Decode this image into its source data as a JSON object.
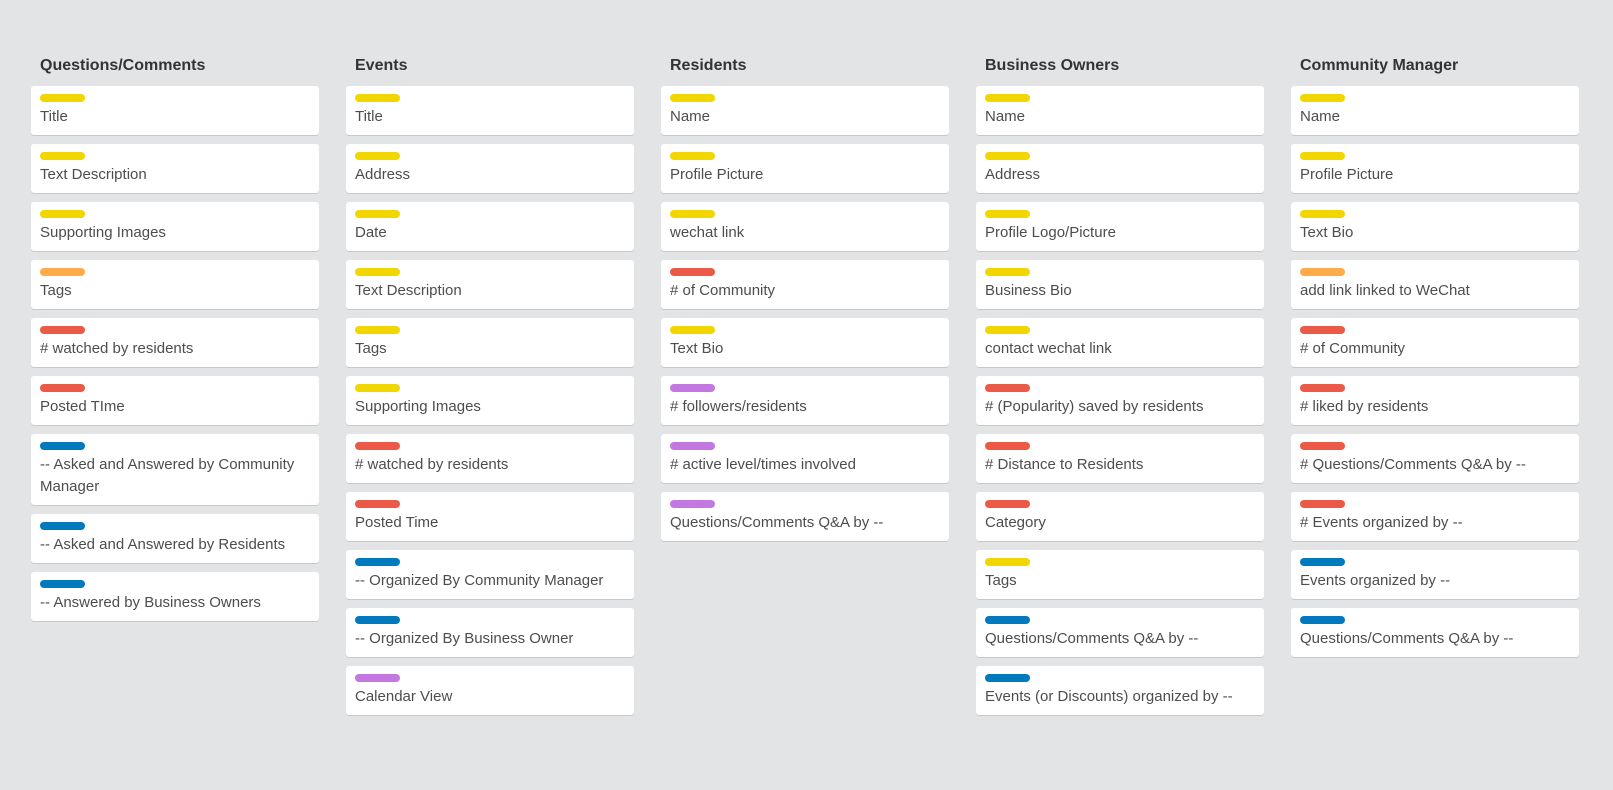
{
  "label_colors": {
    "yellow": "#f2d600",
    "orange": "#ffab4a",
    "red": "#eb5a46",
    "blue": "#0079bf",
    "purple": "#c377e0"
  },
  "board": {
    "lists": [
      {
        "title": "Questions/Comments",
        "cards": [
          {
            "label": "yellow",
            "text": "Title"
          },
          {
            "label": "yellow",
            "text": "Text Description"
          },
          {
            "label": "yellow",
            "text": "Supporting Images"
          },
          {
            "label": "orange",
            "text": "Tags"
          },
          {
            "label": "red",
            "text": "# watched by residents"
          },
          {
            "label": "red",
            "text": "Posted TIme"
          },
          {
            "label": "blue",
            "text": "-- Asked and Answered by Community Manager"
          },
          {
            "label": "blue",
            "text": "-- Asked and Answered by Residents"
          },
          {
            "label": "blue",
            "text": "-- Answered by Business Owners"
          }
        ]
      },
      {
        "title": "Events",
        "cards": [
          {
            "label": "yellow",
            "text": "Title"
          },
          {
            "label": "yellow",
            "text": "Address"
          },
          {
            "label": "yellow",
            "text": "Date"
          },
          {
            "label": "yellow",
            "text": "Text Description"
          },
          {
            "label": "yellow",
            "text": "Tags"
          },
          {
            "label": "yellow",
            "text": "Supporting Images"
          },
          {
            "label": "red",
            "text": "# watched by residents"
          },
          {
            "label": "red",
            "text": "Posted Time"
          },
          {
            "label": "blue",
            "text": "-- Organized By Community Manager"
          },
          {
            "label": "blue",
            "text": "-- Organized By Business Owner"
          },
          {
            "label": "purple",
            "text": "Calendar View"
          }
        ]
      },
      {
        "title": "Residents",
        "cards": [
          {
            "label": "yellow",
            "text": "Name"
          },
          {
            "label": "yellow",
            "text": "Profile Picture"
          },
          {
            "label": "yellow",
            "text": "wechat link"
          },
          {
            "label": "red",
            "text": "# of Community"
          },
          {
            "label": "yellow",
            "text": "Text Bio"
          },
          {
            "label": "purple",
            "text": "# followers/residents"
          },
          {
            "label": "purple",
            "text": "# active level/times involved"
          },
          {
            "label": "purple",
            "text": "Questions/Comments Q&A by --"
          }
        ]
      },
      {
        "title": "Business Owners",
        "cards": [
          {
            "label": "yellow",
            "text": "Name"
          },
          {
            "label": "yellow",
            "text": "Address"
          },
          {
            "label": "yellow",
            "text": "Profile Logo/Picture"
          },
          {
            "label": "yellow",
            "text": "Business Bio"
          },
          {
            "label": "yellow",
            "text": "contact wechat link"
          },
          {
            "label": "red",
            "text": "# (Popularity) saved by residents"
          },
          {
            "label": "red",
            "text": "# Distance to Residents"
          },
          {
            "label": "red",
            "text": "Category"
          },
          {
            "label": "yellow",
            "text": "Tags"
          },
          {
            "label": "blue",
            "text": "Questions/Comments Q&A by --"
          },
          {
            "label": "blue",
            "text": "Events (or Discounts) organized by --"
          }
        ]
      },
      {
        "title": "Community Manager",
        "cards": [
          {
            "label": "yellow",
            "text": "Name"
          },
          {
            "label": "yellow",
            "text": "Profile Picture"
          },
          {
            "label": "yellow",
            "text": "Text Bio"
          },
          {
            "label": "orange",
            "text": "add link linked to WeChat"
          },
          {
            "label": "red",
            "text": "# of Community"
          },
          {
            "label": "red",
            "text": "# liked by residents"
          },
          {
            "label": "red",
            "text": "# Questions/Comments Q&A by --"
          },
          {
            "label": "red",
            "text": "# Events organized by --"
          },
          {
            "label": "blue",
            "text": "Events organized by --"
          },
          {
            "label": "blue",
            "text": "Questions/Comments Q&A by --"
          }
        ]
      }
    ]
  }
}
